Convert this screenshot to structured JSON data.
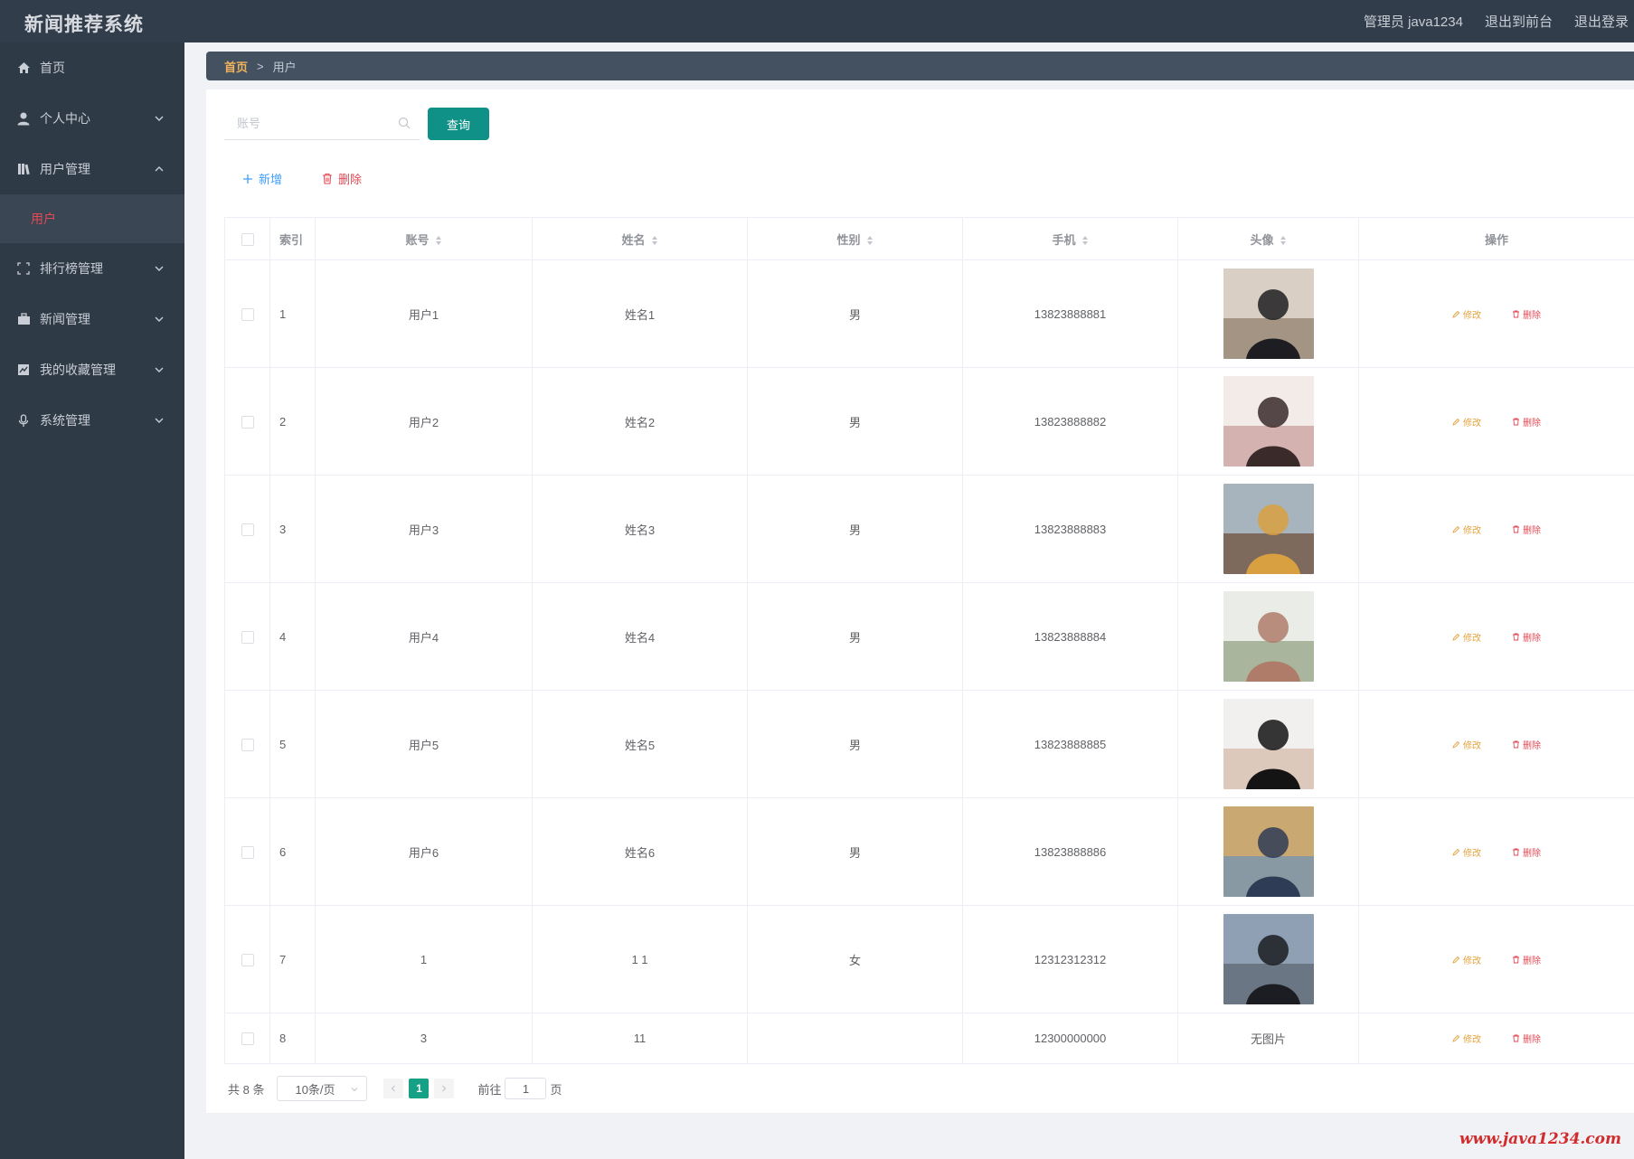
{
  "app": {
    "title": "新闻推荐系统"
  },
  "topnav": {
    "user": "管理员 java1234",
    "to_front": "退出到前台",
    "logout": "退出登录"
  },
  "sidebar": {
    "items": [
      {
        "label": "首页",
        "icon": "home-icon"
      },
      {
        "label": "个人中心",
        "icon": "user-icon"
      },
      {
        "label": "用户管理",
        "icon": "library-icon"
      },
      {
        "label": "排行榜管理",
        "icon": "fullscreen-icon"
      },
      {
        "label": "新闻管理",
        "icon": "briefcase-icon"
      },
      {
        "label": "我的收藏管理",
        "icon": "chart-icon"
      },
      {
        "label": "系统管理",
        "icon": "microphone-icon"
      }
    ],
    "active_sub": "用户"
  },
  "breadcrumb": {
    "home": "首页",
    "sep": ">",
    "current": "用户"
  },
  "search": {
    "placeholder": "账号",
    "value": "",
    "button": "查询"
  },
  "actions": {
    "add": "新增",
    "delete": "删除"
  },
  "table": {
    "headers": {
      "index": "索引",
      "account": "账号",
      "name": "姓名",
      "gender": "性别",
      "phone": "手机",
      "avatar": "头像",
      "ops": "操作"
    },
    "op_edit": "修改",
    "op_delete": "删除",
    "no_image": "无图片",
    "rows": [
      {
        "index": "1",
        "account": "用户1",
        "name": "姓名1",
        "gender": "男",
        "phone": "13823888881",
        "avatar_colors": [
          "#d9cfc4",
          "#8d7b6a",
          "#1e1e22"
        ]
      },
      {
        "index": "2",
        "account": "用户2",
        "name": "姓名2",
        "gender": "男",
        "phone": "13823888882",
        "avatar_colors": [
          "#f2ebe8",
          "#c89a98",
          "#3a2a2a"
        ]
      },
      {
        "index": "3",
        "account": "用户3",
        "name": "姓名3",
        "gender": "男",
        "phone": "13823888883",
        "avatar_colors": [
          "#a8b4bd",
          "#6b4a33",
          "#d8a040"
        ]
      },
      {
        "index": "4",
        "account": "用户4",
        "name": "姓名4",
        "gender": "男",
        "phone": "13823888884",
        "avatar_colors": [
          "#e9ece7",
          "#8da07e",
          "#b07c6a"
        ]
      },
      {
        "index": "5",
        "account": "用户5",
        "name": "姓名5",
        "gender": "男",
        "phone": "13823888885",
        "avatar_colors": [
          "#f2f0ee",
          "#d3b8a6",
          "#141414"
        ]
      },
      {
        "index": "6",
        "account": "用户6",
        "name": "姓名6",
        "gender": "男",
        "phone": "13823888886",
        "avatar_colors": [
          "#c9a872",
          "#6e93b8",
          "#2f3c55"
        ]
      },
      {
        "index": "7",
        "account": "1",
        "name": "1 1",
        "gender": "女",
        "phone": "12312312312",
        "avatar_colors": [
          "#8fa0b5",
          "#5b6470",
          "#1b1d22"
        ]
      },
      {
        "index": "8",
        "account": "3",
        "name": "11",
        "gender": "",
        "phone": "12300000000",
        "avatar_colors": []
      }
    ]
  },
  "pagination": {
    "total": "共 8 条",
    "page_size": "10条/页",
    "current": "1",
    "goto_label": "前往",
    "goto_value": "1",
    "page_suffix": "页"
  },
  "watermark": "www.java1234.com",
  "colors": {
    "accent": "#0f9187",
    "danger": "#e24a55",
    "warning": "#e6a23c",
    "sidebar": "#2f3a47"
  }
}
